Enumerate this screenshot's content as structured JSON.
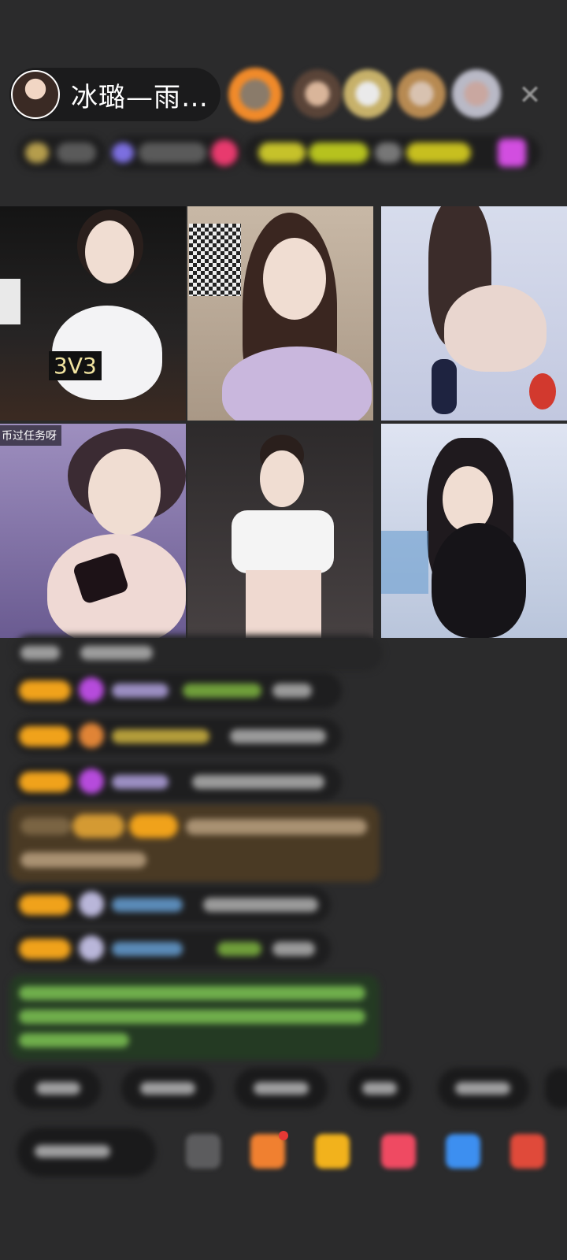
{
  "header": {
    "host_name": "冰璐—雨…",
    "close_glyph": "✕"
  },
  "grid": {
    "tiles": [
      {
        "id": 1,
        "badge": "3V3"
      },
      {
        "id": 2
      },
      {
        "id": 3
      },
      {
        "id": 4,
        "caption": "币过任务呀"
      },
      {
        "id": 5
      },
      {
        "id": 6
      }
    ]
  },
  "colors": {
    "background": "#2b2b2c",
    "level_badge": "#f0a21b",
    "gift_message_bg": "#4a3a24",
    "system_message_bg": "#243a23"
  },
  "icons": [
    "close-icon",
    "host-avatar",
    "viewer-avatar",
    "gift-icon",
    "gem-icon"
  ]
}
